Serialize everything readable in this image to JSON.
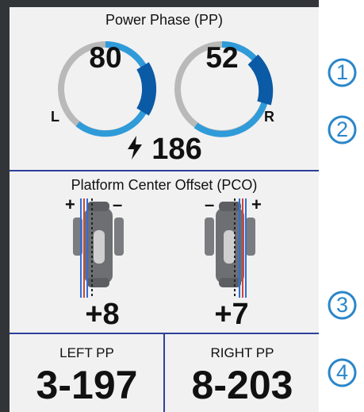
{
  "power_phase": {
    "title": "Power Phase (PP)",
    "left_value": "80",
    "right_value": "52",
    "left_side": "L",
    "right_side": "R",
    "power_value": "186",
    "power_icon": "lightning-bolt-icon"
  },
  "pco": {
    "title": "Platform Center Offset (PCO)",
    "left_plus": "+",
    "left_minus": "–",
    "right_minus": "–",
    "right_plus": "+",
    "left_offset": "+8",
    "right_offset": "+7",
    "pedal_icon": "pedal-icon"
  },
  "pp_ranges": {
    "left_label": "LEFT PP",
    "left_value": "3-197",
    "right_label": "RIGHT PP",
    "right_value": "8-203"
  },
  "callouts": [
    "1",
    "2",
    "3",
    "4"
  ],
  "colors": {
    "accent_blue": "#2f9bd9",
    "peak_blue": "#0b5aa6",
    "ring_gray": "#b9b9b9",
    "separator": "#2f3f9c",
    "callout_blue": "#2a86c9",
    "red_line": "#d0453c",
    "blue_line": "#2f6fd6"
  }
}
